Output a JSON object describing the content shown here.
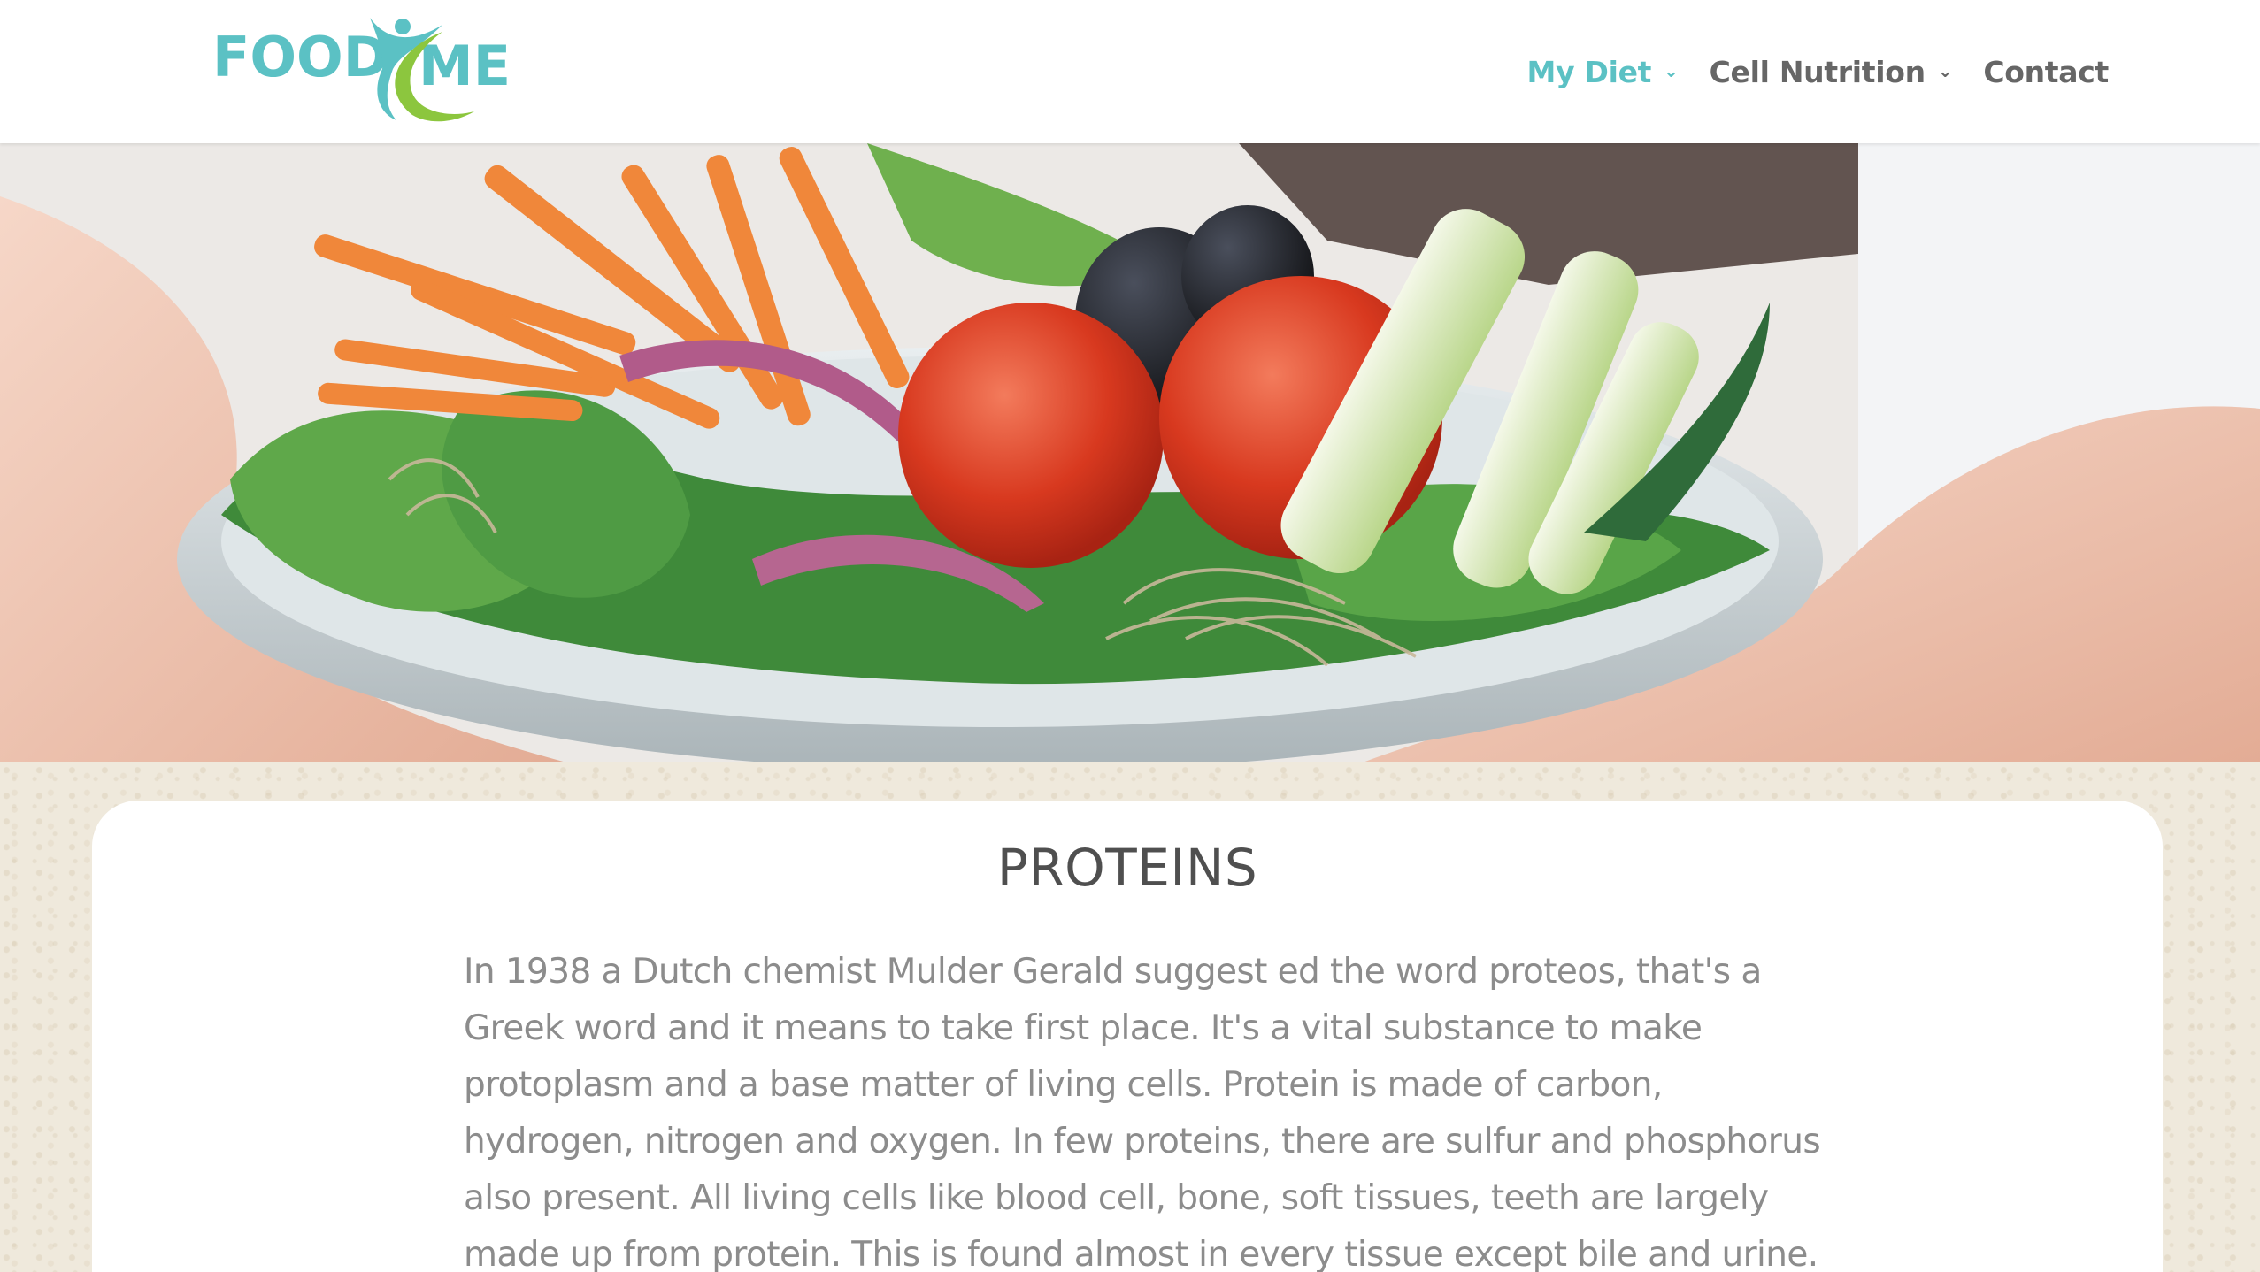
{
  "header": {
    "logo": {
      "text_left": "FOOD",
      "text_right": "ME",
      "brand_color": "#5bc1c4",
      "swoosh_color": "#8cc63e"
    },
    "nav": [
      {
        "label": "My Diet",
        "has_dropdown": true,
        "active": true
      },
      {
        "label": "Cell Nutrition",
        "has_dropdown": true,
        "active": false
      },
      {
        "label": "Contact",
        "has_dropdown": false,
        "active": false
      }
    ],
    "nav_color": "#666666",
    "nav_active_color": "#5bc1c4"
  },
  "hero": {
    "image": "salad-plate-photo"
  },
  "article": {
    "title": "PROTEINS",
    "body": "In 1938 a Dutch chemist Mulder Gerald suggest ed the word proteos, that's a Greek word and it means to take first place. It's a vital substance to make protoplasm and a base matter of living cells. Protein is made of carbon, hydrogen, nitrogen and oxygen. In few proteins, there are sulfur and phosphorus also present. All living cells like blood cell, bone, soft tissues, teeth are largely made up from protein. This is found almost in every tissue except bile and urine."
  }
}
